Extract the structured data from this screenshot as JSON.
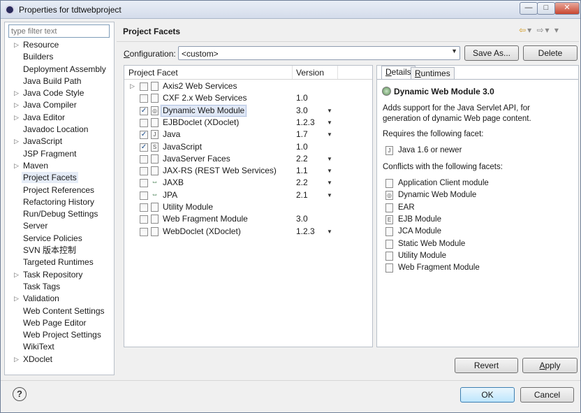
{
  "window": {
    "title": "Properties for tdtwebproject",
    "min_glyph": "—",
    "max_glyph": "□",
    "close_glyph": "✕"
  },
  "sidebar": {
    "filter_placeholder": "type filter text",
    "items": [
      {
        "label": "Resource",
        "expandable": true
      },
      {
        "label": "Builders",
        "expandable": false
      },
      {
        "label": "Deployment Assembly",
        "expandable": false
      },
      {
        "label": "Java Build Path",
        "expandable": false
      },
      {
        "label": "Java Code Style",
        "expandable": true
      },
      {
        "label": "Java Compiler",
        "expandable": true
      },
      {
        "label": "Java Editor",
        "expandable": true
      },
      {
        "label": "Javadoc Location",
        "expandable": false
      },
      {
        "label": "JavaScript",
        "expandable": true
      },
      {
        "label": "JSP Fragment",
        "expandable": false
      },
      {
        "label": "Maven",
        "expandable": true
      },
      {
        "label": "Project Facets",
        "expandable": false,
        "selected": true
      },
      {
        "label": "Project References",
        "expandable": false
      },
      {
        "label": "Refactoring History",
        "expandable": false
      },
      {
        "label": "Run/Debug Settings",
        "expandable": false
      },
      {
        "label": "Server",
        "expandable": false
      },
      {
        "label": "Service Policies",
        "expandable": false
      },
      {
        "label": "SVN 版本控制",
        "expandable": false
      },
      {
        "label": "Targeted Runtimes",
        "expandable": false
      },
      {
        "label": "Task Repository",
        "expandable": true
      },
      {
        "label": "Task Tags",
        "expandable": false
      },
      {
        "label": "Validation",
        "expandable": true
      },
      {
        "label": "Web Content Settings",
        "expandable": false
      },
      {
        "label": "Web Page Editor",
        "expandable": false
      },
      {
        "label": "Web Project Settings",
        "expandable": false
      },
      {
        "label": "WikiText",
        "expandable": false
      },
      {
        "label": "XDoclet",
        "expandable": true
      }
    ]
  },
  "page": {
    "title": "Project Facets",
    "back_glyph": "⇦",
    "forward_glyph": "⇨",
    "menu_glyph": "▾"
  },
  "config": {
    "label_prefix": "",
    "label_mnemonic": "C",
    "label_rest": "onfiguration:",
    "value": "<custom>",
    "save_as": "Save As...",
    "delete": "Delete"
  },
  "table": {
    "col_facet": "Project Facet",
    "col_version": "Version",
    "rows": [
      {
        "name": "Axis2 Web Services",
        "version": "",
        "checked": false,
        "expandable": true,
        "dropdown": false,
        "icon": "doc"
      },
      {
        "name": "CXF 2.x Web Services",
        "version": "1.0",
        "checked": false,
        "expandable": false,
        "dropdown": false,
        "icon": "doc"
      },
      {
        "name": "Dynamic Web Module",
        "version": "3.0",
        "checked": true,
        "expandable": false,
        "dropdown": true,
        "icon": "web",
        "selected": true
      },
      {
        "name": "EJBDoclet (XDoclet)",
        "version": "1.2.3",
        "checked": false,
        "expandable": false,
        "dropdown": true,
        "icon": "doc"
      },
      {
        "name": "Java",
        "version": "1.7",
        "checked": true,
        "expandable": false,
        "dropdown": true,
        "icon": "java"
      },
      {
        "name": "JavaScript",
        "version": "1.0",
        "checked": true,
        "expandable": false,
        "dropdown": false,
        "icon": "js"
      },
      {
        "name": "JavaServer Faces",
        "version": "2.2",
        "checked": false,
        "expandable": false,
        "dropdown": true,
        "icon": "doc"
      },
      {
        "name": "JAX-RS (REST Web Services)",
        "version": "1.1",
        "checked": false,
        "expandable": false,
        "dropdown": true,
        "icon": "doc"
      },
      {
        "name": "JAXB",
        "version": "2.2",
        "checked": false,
        "expandable": false,
        "dropdown": true,
        "icon": "arrows"
      },
      {
        "name": "JPA",
        "version": "2.1",
        "checked": false,
        "expandable": false,
        "dropdown": true,
        "icon": "arrows"
      },
      {
        "name": "Utility Module",
        "version": "",
        "checked": false,
        "expandable": false,
        "dropdown": false,
        "icon": "doc"
      },
      {
        "name": "Web Fragment Module",
        "version": "3.0",
        "checked": false,
        "expandable": false,
        "dropdown": false,
        "icon": "doc"
      },
      {
        "name": "WebDoclet (XDoclet)",
        "version": "1.2.3",
        "checked": false,
        "expandable": false,
        "dropdown": true,
        "icon": "doc"
      }
    ]
  },
  "details": {
    "tab_details_mnemonic": "D",
    "tab_details_rest": "etails",
    "tab_runtimes_mnemonic": "R",
    "tab_runtimes_rest": "untimes",
    "heading": "Dynamic Web Module 3.0",
    "desc_line1": "Adds support for the Java Servlet API, for",
    "desc_line2": "generation of dynamic Web page content.",
    "requires_label": "Requires the following facet:",
    "requires": [
      {
        "label": "Java 1.6 or newer",
        "icon": "java"
      }
    ],
    "conflicts_label": "Conflicts with the following facets:",
    "conflicts": [
      {
        "label": "Application Client module",
        "icon": "doc"
      },
      {
        "label": "Dynamic Web Module",
        "icon": "web"
      },
      {
        "label": "EAR",
        "icon": "doc"
      },
      {
        "label": "EJB Module",
        "icon": "ejb"
      },
      {
        "label": "JCA Module",
        "icon": "doc"
      },
      {
        "label": "Static Web Module",
        "icon": "doc"
      },
      {
        "label": "Utility Module",
        "icon": "doc"
      },
      {
        "label": "Web Fragment Module",
        "icon": "doc"
      }
    ]
  },
  "footer": {
    "revert": "Revert",
    "apply_mnemonic": "A",
    "apply_rest": "pply",
    "ok": "OK",
    "cancel": "Cancel",
    "help_glyph": "?"
  }
}
